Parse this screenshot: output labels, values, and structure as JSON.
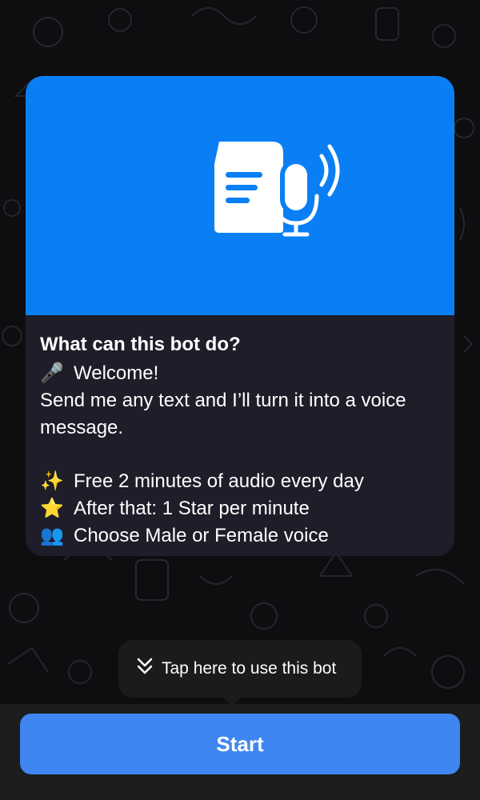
{
  "bot_info": {
    "title": "What can this bot do?",
    "lines": [
      {
        "emoji": "🎤",
        "text": "Welcome!"
      },
      {
        "emoji": "",
        "text": "Send me any text and I’ll turn it into a voice message."
      }
    ],
    "features": [
      {
        "emoji": "✨",
        "text": "Free 2 minutes of audio every day"
      },
      {
        "emoji": "⭐",
        "text": "After that: 1 Star per minute"
      },
      {
        "emoji": "👥",
        "text": "Choose Male or Female voice"
      }
    ]
  },
  "tooltip": {
    "text": "Tap here to use this bot"
  },
  "start_button": {
    "label": "Start"
  },
  "colors": {
    "hero": "#0a7ff4",
    "card": "#1f1d29",
    "button": "#3f86f0"
  }
}
